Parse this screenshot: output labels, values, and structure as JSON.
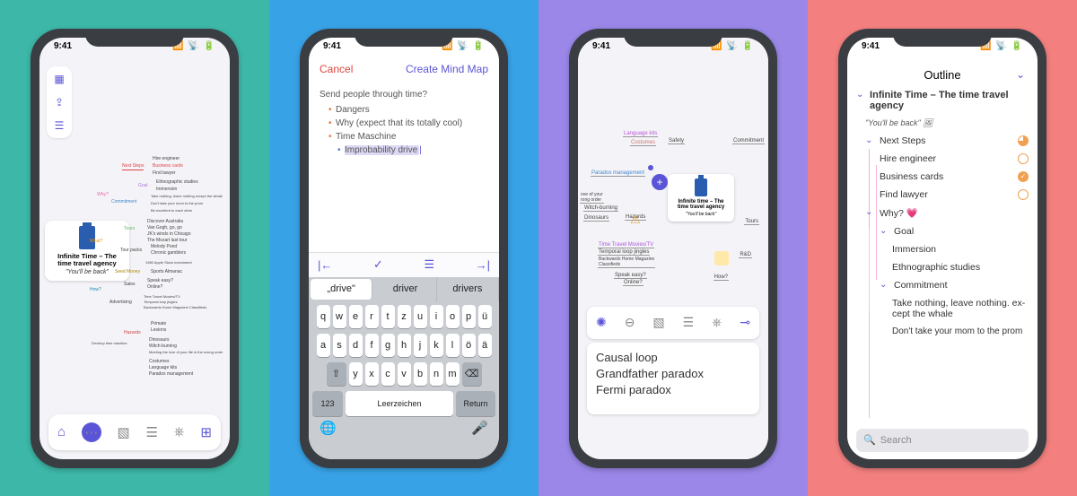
{
  "status": {
    "time": "9:41",
    "indicators": "▮◉ ▯▯▮"
  },
  "screen1": {
    "sidebar_icons": [
      "grid",
      "share",
      "list"
    ],
    "card": {
      "title": "Infinite Time – The time travel agency",
      "subtitle": "\"You'll be back\""
    },
    "mindmap": {
      "c1": "Next Steps",
      "c1a": "Hire engineer",
      "c1b": "Business cards",
      "c1c": "Find lawyer",
      "c2": "Goal",
      "c2a": "Ethnographic studies",
      "c2b": "Immersion",
      "c3": "Commitment",
      "c3a": "Take nothing, leave nothing except the whale",
      "c3b": "Don't take your mom to the prom",
      "c3c": "Be excellent to each other",
      "c4": "Why?",
      "c5": "Tours",
      "c5a": "Discover Australia",
      "c5b": "Van Gogh, go, go",
      "c5c": "JK's winds in Chicago",
      "c5d": "The Mozart last tour",
      "c6": "Tour packs",
      "c6a": "Melody Pond",
      "c6b": "Chronic gamblers",
      "c7": "What?",
      "c8": "1980 Apple Stock investment",
      "c9": "Seed Money",
      "c9a": "Sports Almanac",
      "c10": "Sales",
      "c10a": "Speak easy?",
      "c10b": "Online?",
      "c11": "Advertising",
      "c11a": "Time Travel Movies/TV",
      "c11b": "Temporal loop jingles",
      "c11c": "Backwards Home Magazine Classifieds",
      "c12": "How?",
      "c13": "Hazards",
      "c13a": "Primate",
      "c13b": "Lesions",
      "c14": "Develop time machine",
      "c14a": "Dinosaurs",
      "c14b": "Witch-burning",
      "c14c": "Meeting the love of your life in the wrong order",
      "c14d": "Costumes",
      "c14e": "Language kits",
      "c14f": "Paradox management"
    },
    "toolbar": {
      "tree": "tree",
      "chat": "chat",
      "image": "image",
      "notes": "notes",
      "style": "style",
      "layers": "layers"
    }
  },
  "screen2": {
    "cancel": "Cancel",
    "create": "Create Mind Map",
    "root": "Send people through time?",
    "items": [
      "Dangers",
      "Why (expect that its totally cool)",
      "Time Maschine"
    ],
    "editing": "Improbability drive",
    "suggestions": [
      "„drive\"",
      "driver",
      "drivers"
    ],
    "kbd_row1": [
      "q",
      "w",
      "e",
      "r",
      "t",
      "z",
      "u",
      "i",
      "o",
      "p",
      "ü"
    ],
    "kbd_row2": [
      "a",
      "s",
      "d",
      "f",
      "g",
      "h",
      "j",
      "k",
      "l",
      "ö",
      "ä"
    ],
    "kbd_row3": [
      "⇧",
      "y",
      "x",
      "c",
      "v",
      "b",
      "n",
      "m",
      "⌫"
    ],
    "kbd_123": "123",
    "kbd_space": "Leerzeichen",
    "kbd_return": "Return"
  },
  "screen3": {
    "card_title": "Infinite time – The time travel agency",
    "card_sub": "\"You'll be back\"",
    "nodes": {
      "topl": "Language kits",
      "top2": "Costumes",
      "top3": "Safety",
      "topc": "Commitment",
      "pm": "Paradox management",
      "haz": "Hazards",
      "wb": "Witch-burning",
      "din": "Dinosaurs",
      "love": "ove of your\nrong order",
      "ttm": "Time Travel Movies/TV",
      "tlj": "Temporal loop jingles",
      "bhm": "Backwards Home Magazine\nClassifieds",
      "se": "Speak easy?",
      "ol": "Online?",
      "rd": "R&D",
      "tours": "Tours",
      "how": "How?"
    },
    "notes": [
      "Causal loop",
      "Grandfather paradox",
      "Fermi paradox"
    ]
  },
  "screen4": {
    "title": "Outline",
    "root_title": "Infinite Time – The time travel agency",
    "root_sub": "\"You'll be back\" 🖼",
    "nextsteps": "Next Steps",
    "hire": "Hire engineer",
    "biz": "Business cards",
    "lawyer": "Find lawyer",
    "why": "Why? 💗",
    "goal": "Goal",
    "imm": "Immersion",
    "eth": "Ethnographic studies",
    "commit": "Commitment",
    "take": "Take nothing, leave nothing. ex-\ncept the whale",
    "mom": "Don't take your mom to the prom",
    "search_ph": "Search"
  }
}
